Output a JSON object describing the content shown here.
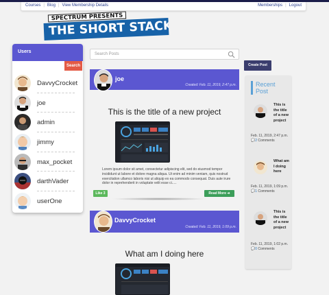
{
  "topnav": {
    "left": [
      "Courses",
      "Blog",
      "View Membership Details"
    ],
    "right": [
      "Memberships",
      "Logout"
    ]
  },
  "logo": {
    "subtitle": "SPECTRUM PRESENTS",
    "title": "THE SHORT STACK"
  },
  "users_panel": {
    "title": "Users",
    "search_button": "Search",
    "users": [
      "DavvyCrocket",
      "joe",
      "admin",
      "jimmy",
      "max_pocket",
      "darthVader",
      "userOne"
    ]
  },
  "search": {
    "placeholder": "Search Posts",
    "icon": "search-icon"
  },
  "posts": [
    {
      "author": "joe",
      "date": "Created: Feb. 11, 2019, 2:47 p.m.",
      "title": "This is the title of a new project",
      "body": "Lorem ipsum dolor sit amet, consectetur adipiscing elit, sed do eiusmod tempor incididunt ut labore et dolore magna aliqua. Ut enim ad minim veniam, quis nostrud exercitation ullamco laboris nisi ut aliquip ex ea commodo consequat. Duis aute irure dolor in reprehenderit in voluptate velit esse ci.....",
      "like_label": "Like 3",
      "read_more_label": "Read More ➔"
    },
    {
      "author": "DavvyCrocket",
      "date": "Created: Feb. 11, 2019, 1:09 p.m.",
      "title": "What am I doing here"
    }
  ],
  "create_post_label": "Create Post",
  "recent_posts": {
    "title": "Recent Post",
    "items": [
      {
        "title": "This is the title of a new project",
        "date": "Feb. 11, 2019, 2:47 p.m.",
        "comments": "2",
        "comments_label": "Comments"
      },
      {
        "title": "What am I doing here",
        "date": "Feb. 11, 2019, 1:09 p.m.",
        "comments": "1",
        "comments_label": "Comments"
      },
      {
        "title": "This is the title of a new project",
        "date": "Feb. 11, 2019, 1:02 p.m.",
        "comments": "0",
        "comments_label": "Comments"
      }
    ]
  },
  "colors": {
    "accent": "#5b57d1",
    "search_button": "#e45a45",
    "like": "#5cb85c",
    "read_more": "#3c9e5a",
    "recent_title": "#5aa0d6"
  }
}
